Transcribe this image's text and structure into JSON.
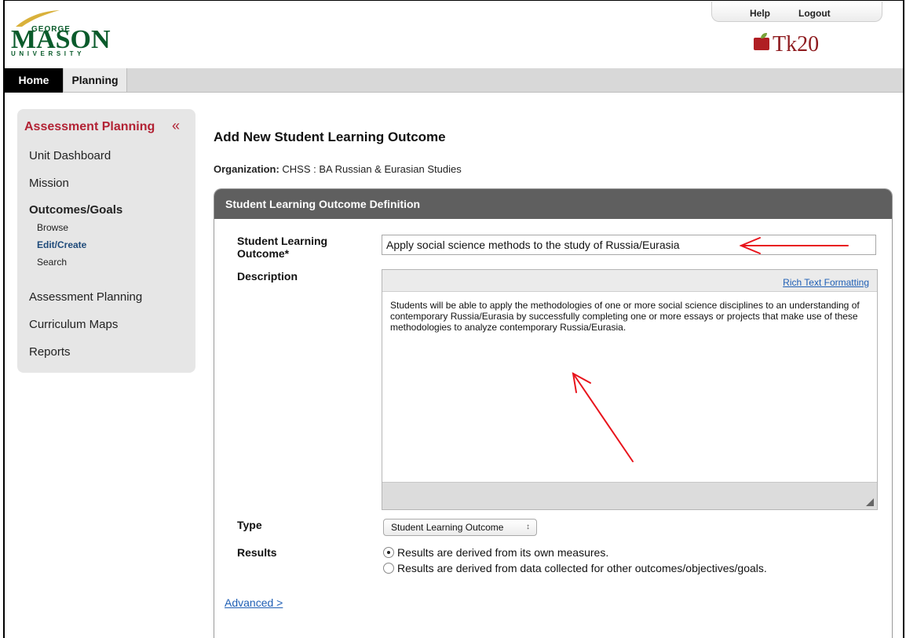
{
  "header": {
    "logo": {
      "top": "GEORGE",
      "main": "MASON",
      "bottom": "UNIVERSITY"
    },
    "links": {
      "help": "Help",
      "logout": "Logout"
    },
    "brand": "Tk20"
  },
  "nav": {
    "home": "Home",
    "planning": "Planning"
  },
  "sidebar": {
    "title": "Assessment Planning",
    "collapse_glyph": "«",
    "items": {
      "unit_dashboard": "Unit Dashboard",
      "mission": "Mission",
      "outcomes_goals": "Outcomes/Goals",
      "browse": "Browse",
      "edit_create": "Edit/Create",
      "search": "Search",
      "assessment_planning": "Assessment Planning",
      "curriculum_maps": "Curriculum Maps",
      "reports": "Reports"
    }
  },
  "main": {
    "title": "Add New Student Learning Outcome",
    "org_label": "Organization:",
    "org_value": "CHSS : BA Russian & Eurasian Studies",
    "panel_title": "Student Learning Outcome Definition",
    "fields": {
      "slo_label_1": "Student Learning",
      "slo_label_2": "Outcome*",
      "slo_value": "Apply social science methods to the study of Russia/Eurasia",
      "description_label": "Description",
      "rich_text_link": "Rich Text Formatting",
      "description_text": "Students will be able to apply the methodologies of one or more social science disciplines to an understanding of contemporary Russia/Eurasia by successfully completing one or more essays or projects that make use of these methodologies to analyze contemporary Russia/Eurasia.",
      "type_label": "Type",
      "type_value": "Student Learning Outcome",
      "results_label": "Results",
      "results_option_1": "Results are derived from its own measures.",
      "results_option_2": "Results are derived from data collected for other outcomes/objectives/goals."
    },
    "advanced_link": "Advanced >"
  },
  "colors": {
    "accent_red": "#b22234",
    "panel_header": "#5f5f5f",
    "link_blue": "#1f5fb5",
    "mason_green": "#0a5b2b",
    "annotation_arrow": "#e8141c"
  },
  "icons": [
    "chevron-double-left-icon",
    "select-arrows-icon",
    "resize-grip-icon",
    "annotation-arrow-icon"
  ]
}
